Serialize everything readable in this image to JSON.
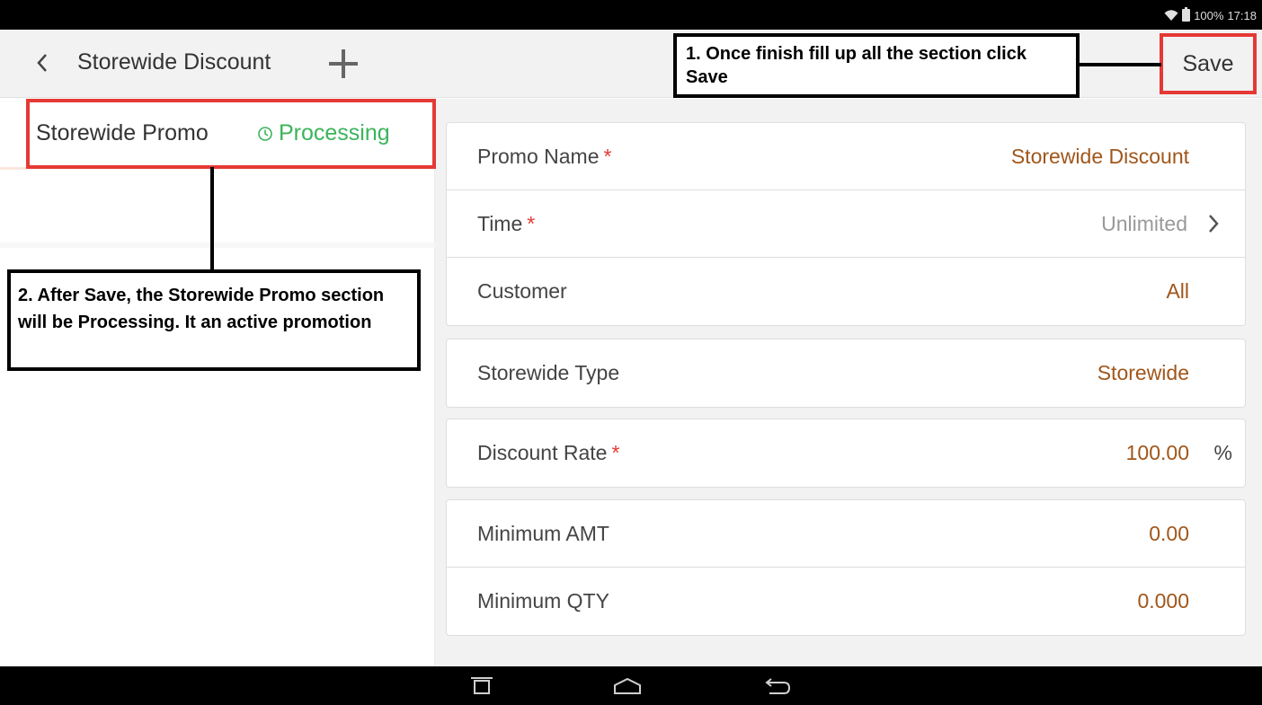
{
  "status_bar": {
    "battery": "100%",
    "time": "17:18",
    "icons": [
      "wifi-icon",
      "battery-icon"
    ]
  },
  "app_bar": {
    "back_icon": "chevron-left-icon",
    "title": "Storewide Discount",
    "add_icon": "plus-icon",
    "save_label": "Save"
  },
  "promo_list": {
    "items": [
      {
        "name": "Storewide Promo",
        "status": "Processing",
        "status_icon": "clock-icon",
        "status_color": "#3bb45c"
      }
    ]
  },
  "form": {
    "sections": [
      {
        "rows": [
          {
            "label": "Promo Name",
            "required": true,
            "value": "Storewide Discount"
          },
          {
            "label": "Time",
            "required": true,
            "value": "Unlimited",
            "chevron": true
          },
          {
            "label": "Customer",
            "required": false,
            "value": "All"
          }
        ]
      },
      {
        "rows": [
          {
            "label": "Storewide Type",
            "required": false,
            "value": "Storewide"
          }
        ]
      },
      {
        "rows": [
          {
            "label": "Discount Rate",
            "required": true,
            "value": "100.00",
            "unit": "%"
          }
        ]
      },
      {
        "rows": [
          {
            "label": "Minimum AMT",
            "required": false,
            "value": "0.00"
          },
          {
            "label": "Minimum QTY",
            "required": false,
            "value": "0.000"
          }
        ]
      }
    ],
    "required_marker": "*"
  },
  "annotations": {
    "step1": "1. Once finish fill up all the section click Save",
    "step2": "2. After Save, the Storewide Promo section will be Processing. It an active promotion"
  },
  "nav_bar": {
    "icons": [
      "recent-apps-icon",
      "home-icon",
      "back-icon"
    ]
  },
  "colors": {
    "accent_value": "#a0561a",
    "required": "#e53935",
    "processing": "#3bb45c",
    "highlight_box": "#e53935"
  }
}
